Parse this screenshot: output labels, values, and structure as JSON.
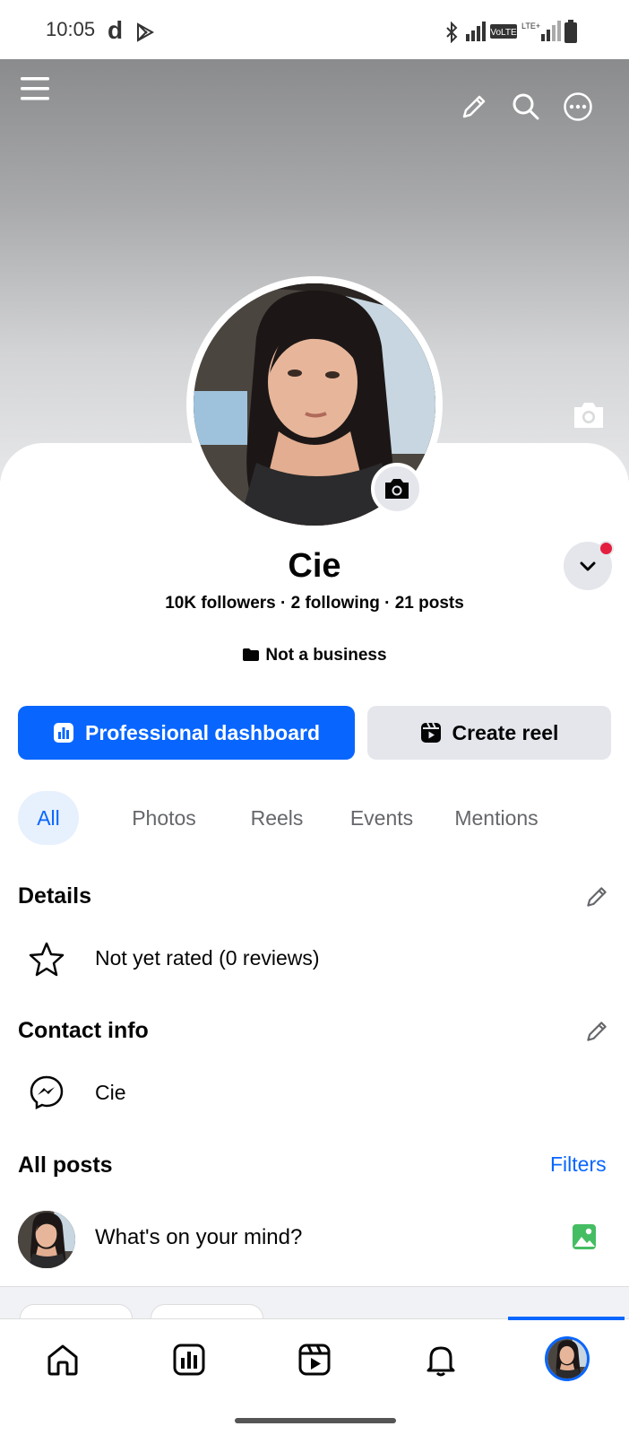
{
  "status_bar": {
    "time": "10:05"
  },
  "profile": {
    "name": "Cie",
    "stats": "10K followers · 2 following · 21 posts",
    "business_label": "Not a business"
  },
  "actions": {
    "professional_dashboard": "Professional dashboard",
    "create_reel": "Create reel"
  },
  "tabs": [
    {
      "label": "All",
      "selected": true
    },
    {
      "label": "Photos"
    },
    {
      "label": "Reels"
    },
    {
      "label": "Events"
    },
    {
      "label": "Mentions"
    }
  ],
  "details": {
    "title": "Details",
    "rating": "Not yet rated (0 reviews)"
  },
  "contact_info": {
    "title": "Contact info",
    "messenger": "Cie"
  },
  "all_posts": {
    "title": "All posts",
    "filters": "Filters",
    "composer_placeholder": "What's on your mind?"
  },
  "colors": {
    "accent": "#0866ff",
    "secondary_button": "#e4e6eb",
    "notification_dot": "#e41e3f",
    "photo_icon": "#45bd62"
  },
  "icons": {
    "header": [
      "menu-icon",
      "pencil-icon",
      "search-icon",
      "more-icon"
    ],
    "bottom_nav": [
      "home-icon",
      "dashboard-icon",
      "reels-icon",
      "bell-icon",
      "profile-avatar"
    ]
  }
}
